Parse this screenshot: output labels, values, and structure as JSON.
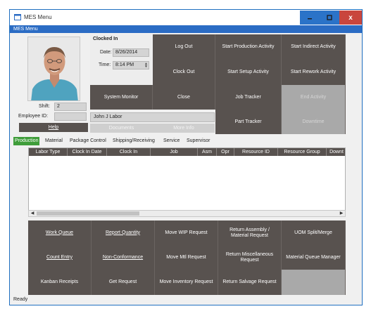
{
  "window": {
    "title": "MES Menu",
    "menu_label": "MES Menu",
    "close_glyph": "x"
  },
  "clock": {
    "title": "Clocked In",
    "date_label": "Date:",
    "date_value": "8/26/2014",
    "time_label": "Time:",
    "time_value": "8:14 PM"
  },
  "employee": {
    "shift_label": "Shift:",
    "shift_value": "2",
    "id_label": "Employee ID:",
    "id_value": "",
    "name": "John J Labor"
  },
  "buttons": {
    "system_monitor": "System Monitor",
    "log_out": "Log Out",
    "clock_out": "Clock Out",
    "close": "Close",
    "start_production": "Start Production Activity",
    "start_setup": "Start Setup Activity",
    "job_tracker": "Job Tracker",
    "part_tracker": "Part Tracker",
    "start_indirect": "Start Indirect Activity",
    "start_rework": "Start Rework Activity",
    "end_activity": "End Activity",
    "downtime": "Downtime",
    "help": "Help",
    "documents": "Documents",
    "more_info": "More Info"
  },
  "tabs": [
    "Production",
    "Material",
    "Package Control",
    "Shipping/Receiving",
    "Service",
    "Supervisor"
  ],
  "grid": {
    "columns": [
      "Labor Type",
      "Clock In Date",
      "Clock In",
      "Job",
      "Asm",
      "Opr",
      "Resource ID",
      "Resource Group",
      "Downt"
    ]
  },
  "actions": {
    "work_queue": "Work Queue",
    "report_quantity": "Report Quantity",
    "move_wip": "Move WIP Request",
    "return_assembly": "Return Assembly / Material Request",
    "uom_split": "UOM Split/Merge",
    "count_entry": "Count Entry",
    "non_conformance": "Non-Conformance",
    "move_mtl": "Move Mtl Request",
    "return_misc": "Return Miscellaneous Request",
    "material_queue": "Material Queue Manager",
    "kanban": "Kanban Receipts",
    "get_request": "Get Request",
    "move_inventory": "Move Inventory Request",
    "return_salvage": "Return Salvage Request"
  },
  "status": "Ready",
  "colors": {
    "button_dark": "#58524f",
    "button_disabled": "#a9a9a9",
    "tab_active": "#3f9d3a",
    "titlebar_accent": "#2b6cc4",
    "close_red": "#c9463d"
  }
}
